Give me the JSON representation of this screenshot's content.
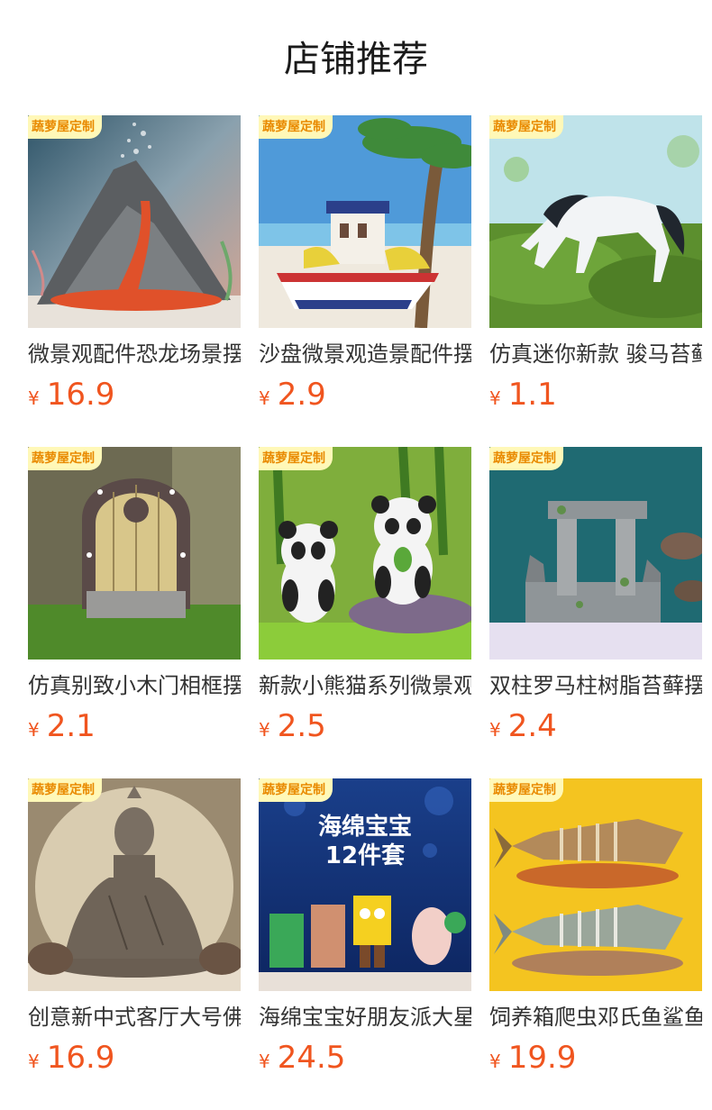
{
  "page": {
    "title": "店铺推荐"
  },
  "shop_badge": "蔬萝屋定制",
  "currency_symbol": "¥",
  "products": [
    {
      "name": "微景观配件恐龙场景摆件",
      "price": "16.9",
      "image": "volcano-ornament"
    },
    {
      "name": "沙盘微景观造景配件摆件",
      "price": "2.9",
      "image": "boat-ornament"
    },
    {
      "name": "仿真迷你新款 骏马苔藓",
      "price": "1.1",
      "image": "horse-figurine"
    },
    {
      "name": "仿真别致小木门相框摆件",
      "price": "2.1",
      "image": "wooden-door-ornament"
    },
    {
      "name": "新款小熊猫系列微景观",
      "price": "2.5",
      "image": "panda-figurines"
    },
    {
      "name": "双柱罗马柱树脂苔藓摆件",
      "price": "2.4",
      "image": "roman-pillar-ruins"
    },
    {
      "name": "创意新中式客厅大号佛像",
      "price": "16.9",
      "image": "buddha-statue"
    },
    {
      "name": "海绵宝宝好朋友派大星",
      "price": "24.5",
      "image": "spongebob-figures"
    },
    {
      "name": "饲养箱爬虫邓氏鱼鲨鱼",
      "price": "19.9",
      "image": "fish-skeleton-ornament"
    }
  ],
  "poster_text": {
    "line1": "海绵宝宝",
    "line2": "12件套"
  },
  "colors": {
    "price": "#f0551f",
    "badge_bg": "#fff8b8",
    "badge_text": "#e98a00"
  }
}
